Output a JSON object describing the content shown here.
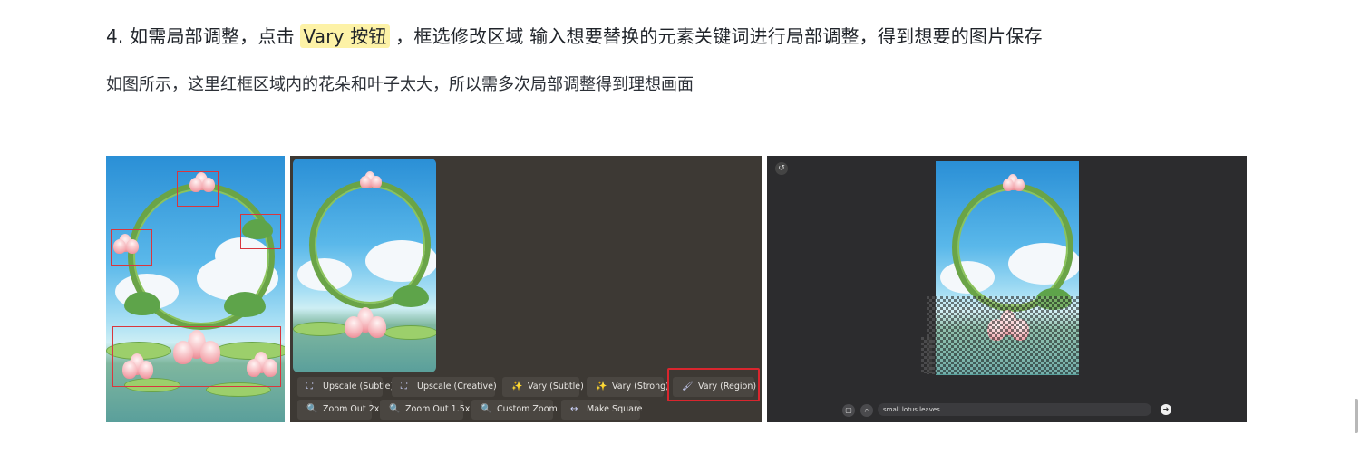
{
  "article": {
    "step_prefix": "4. 如需局部调整，点击 ",
    "step_highlight": "Vary 按钮",
    "step_suffix": " ，框选修改区域 输入想要替换的元素关键词进行局部调整，得到想要的图片保存",
    "description": "如图所示，这里红框区域内的花朵和叶子太大，所以需多次局部调整得到理想画面"
  },
  "midjourney": {
    "row1": [
      {
        "icon": "expand-icon",
        "label": "Upscale (Subtle)"
      },
      {
        "icon": "expand-icon",
        "label": "Upscale (Creative)"
      },
      {
        "icon": "magic-wand-icon",
        "label": "Vary (Subtle)"
      },
      {
        "icon": "magic-wand-icon",
        "label": "Vary (Strong)"
      },
      {
        "icon": "paintbrush-icon",
        "label": "Vary (Region)"
      }
    ],
    "row2": [
      {
        "icon": "magnifier-icon",
        "label": "Zoom Out 2x"
      },
      {
        "icon": "magnifier-icon",
        "label": "Zoom Out 1.5x"
      },
      {
        "icon": "magnifier-icon",
        "label": "Custom Zoom"
      },
      {
        "icon": "arrows-horizontal-icon",
        "label": "Make Square"
      }
    ]
  },
  "editor": {
    "prompt_value": "small lotus leaves"
  },
  "colors": {
    "highlight": "#fdf2a7",
    "red_box": "#d9363e",
    "panel_bg": "#3d3934",
    "editor_bg": "#2c2c2e"
  }
}
